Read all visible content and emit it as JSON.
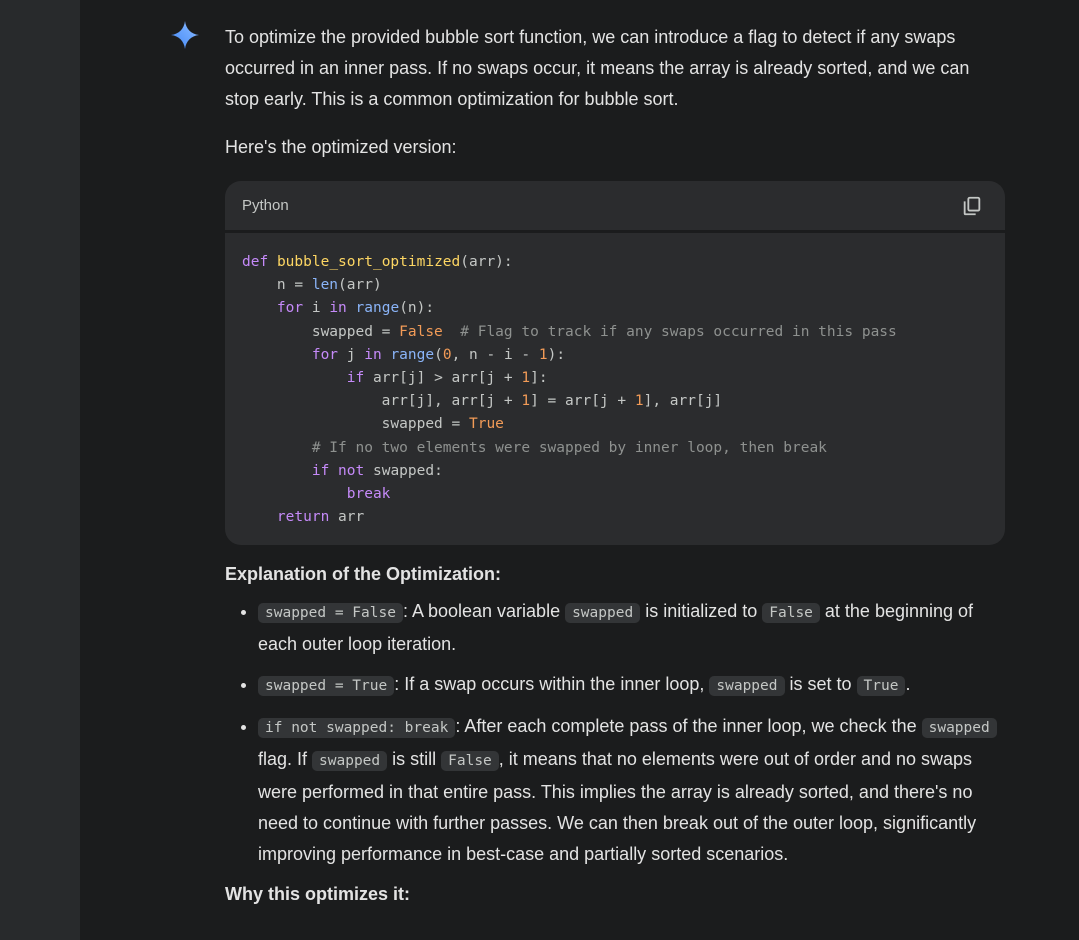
{
  "response": {
    "intro": "To optimize the provided bubble sort function, we can introduce a flag to detect if any swaps occurred in an inner pass. If no swaps occur, it means the array is already sorted, and we can stop early. This is a common optimization for bubble sort.",
    "lead": "Here's the optimized version:",
    "code_block": {
      "language": "Python",
      "copy_icon": "copy-icon",
      "lines": [
        "def bubble_sort_optimized(arr):",
        "    n = len(arr)",
        "    for i in range(n):",
        "        swapped = False  # Flag to track if any swaps occurred in this pass",
        "        for j in range(0, n - i - 1):",
        "            if arr[j] > arr[j + 1]:",
        "                arr[j], arr[j + 1] = arr[j + 1], arr[j]",
        "                swapped = True",
        "        # If no two elements were swapped by inner loop, then break",
        "        if not swapped:",
        "            break",
        "    return arr"
      ]
    },
    "explanation_heading": "Explanation of the Optimization:",
    "bullets": [
      {
        "code": "swapped = False",
        "t1": ": A boolean variable ",
        "c2": "swapped",
        "t2": " is initialized to ",
        "c3": "False",
        "t3": " at the beginning of each outer loop iteration."
      },
      {
        "code": "swapped = True",
        "t1": ": If a swap occurs within the inner loop, ",
        "c2": "swapped",
        "t2": " is set to ",
        "c3": "True",
        "t3": "."
      },
      {
        "code": "if not swapped: break",
        "t1": ": After each complete pass of the inner loop, we check the ",
        "c2": "swapped",
        "t2": " flag. If ",
        "c3": "swapped",
        "t3": " is still ",
        "c4": "False",
        "t4": ", it means that no elements were out of order and no swaps were performed in that entire pass. This implies the array is already sorted, and there's no need to continue with further passes. We can then break out of the outer loop, significantly improving performance in best-case and partially sorted scenarios."
      }
    ],
    "why_heading": "Why this optimizes it:"
  },
  "colors": {
    "background": "#1b1c1d",
    "sidebar": "#282a2c",
    "code_bg": "#2b2c2e",
    "keyword": "#c58af9",
    "function": "#fdd663",
    "builtin": "#8ab4f8",
    "number": "#f29b57",
    "comment": "#8e918f"
  },
  "icons": {
    "assistant": "gemini-spark-icon"
  }
}
